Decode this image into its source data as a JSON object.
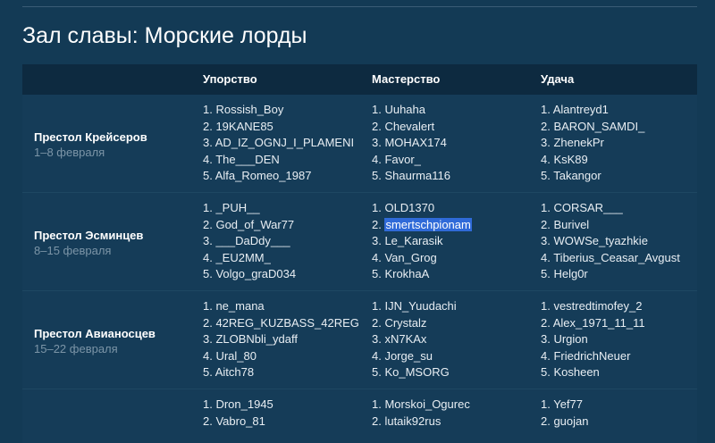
{
  "page": {
    "title": "Зал славы: Морские лорды"
  },
  "table": {
    "headers": [
      "Упорство",
      "Мастерство",
      "Удача"
    ],
    "rows": [
      {
        "name": "Престол Крейсеров",
        "dates": "1–8 февраля",
        "persistence": [
          "1. Rossish_Boy",
          "2. 19KANE85",
          "3. AD_IZ_OGNJ_I_PLAMENI",
          "4. The___DEN",
          "5. Alfa_Romeo_1987"
        ],
        "mastery": [
          "1. Uuhaha",
          "2. Chevalert",
          "3. MOHAX174",
          "4. Favor_",
          "5. Shaurma116"
        ],
        "luck": [
          "1. Alantreyd1",
          "2. BARON_SAMDI_",
          "3. ZhenekPr",
          "4. KsK89",
          "5. Takangor"
        ]
      },
      {
        "name": "Престол Эсминцев",
        "dates": "8–15 февраля",
        "persistence": [
          "1. _PUH__",
          "2. God_of_War77",
          "3. ___DaDdy___",
          "4. _EU2MM_",
          "5. Volgo_graD034"
        ],
        "mastery": [
          "1. OLD1370",
          "2. ",
          "3. Le_Karasik",
          "4. Van_Grog",
          "5. KrokhaA"
        ],
        "mastery_selected": "smertschpionam",
        "luck": [
          "1. CORSAR___",
          "2. Burivel",
          "3. WOWSe_tyazhkie",
          "4. Tiberius_Ceasar_Avgust",
          "5. Helg0r"
        ]
      },
      {
        "name": "Престол Авианосцев",
        "dates": "15–22 февраля",
        "persistence": [
          "1. ne_mana",
          "2. 42REG_KUZBASS_42REG",
          "3. ZLOBNbli_ydaff",
          "4. Ural_80",
          "5. Aitch78"
        ],
        "mastery": [
          "1. IJN_Yuudachi",
          "2. Crystalz",
          "3. xN7KAx",
          "4. Jorge_su",
          "5. Ko_MSORG"
        ],
        "luck": [
          "1. vestredtimofey_2",
          "2. Alex_1971_11_11",
          "3. Urgion",
          "4. FriedrichNeuer",
          "5. Kosheen"
        ]
      },
      {
        "persistence": [
          "1. Dron_1945",
          "2. Vabro_81"
        ],
        "mastery": [
          "1. Morskoi_Ogurec",
          "2. lutaik92rus"
        ],
        "luck": [
          "1. Yef77",
          "2. guojan"
        ]
      }
    ]
  }
}
